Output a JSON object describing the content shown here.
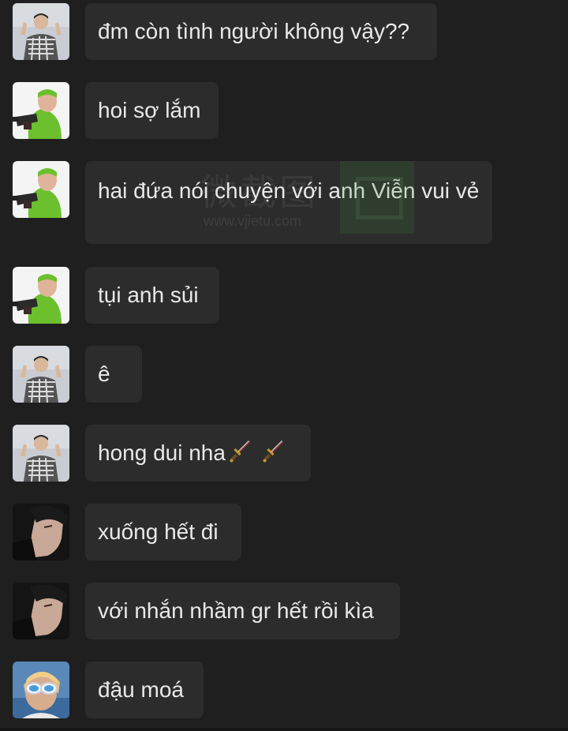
{
  "watermark": {
    "text": "微截图",
    "url": "www.vjietu.com"
  },
  "messages": [
    {
      "avatar": "user-photo-checkered-shirt",
      "text": "đm còn tình người không vậy??"
    },
    {
      "avatar": "user-kermit-meme",
      "text": "hoi sợ lắm"
    },
    {
      "avatar": "user-kermit-meme",
      "text": "hai đứa nói chuyện với anh Viễn vui vẻ"
    },
    {
      "avatar": "user-kermit-meme",
      "text": "tụi anh sủi"
    },
    {
      "avatar": "user-photo-checkered-shirt",
      "text": "ê"
    },
    {
      "avatar": "user-photo-checkered-shirt",
      "text": "hong dui nha",
      "trailing_icons": [
        "dagger-emoji",
        "dagger-emoji"
      ]
    },
    {
      "avatar": "user-photo-side-profile",
      "text": "xuống hết đi"
    },
    {
      "avatar": "user-photo-side-profile",
      "text": "với nhắn nhầm gr hết rồi kìa"
    },
    {
      "avatar": "user-photo-sunglasses",
      "text": "đậu moá"
    }
  ]
}
